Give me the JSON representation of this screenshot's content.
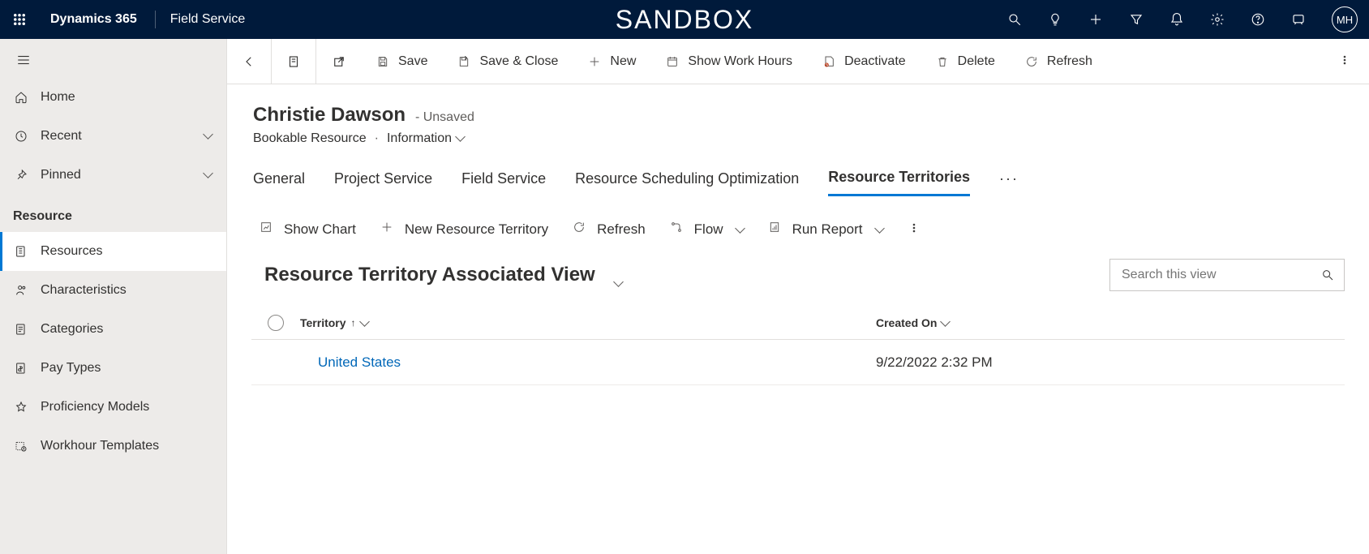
{
  "topbar": {
    "brand": "Dynamics 365",
    "app": "Field Service",
    "environment": "SANDBOX",
    "avatar": "MH"
  },
  "sidebar": {
    "home": "Home",
    "recent": "Recent",
    "pinned": "Pinned",
    "section": "Resource",
    "items": [
      "Resources",
      "Characteristics",
      "Categories",
      "Pay Types",
      "Proficiency Models",
      "Workhour Templates"
    ]
  },
  "cmdbar": {
    "save": "Save",
    "saveClose": "Save & Close",
    "new": "New",
    "workHours": "Show Work Hours",
    "deactivate": "Deactivate",
    "delete": "Delete",
    "refresh": "Refresh"
  },
  "record": {
    "title": "Christie Dawson",
    "status": "- Unsaved",
    "entity": "Bookable Resource",
    "form": "Information"
  },
  "tabs": [
    "General",
    "Project Service",
    "Field Service",
    "Resource Scheduling Optimization",
    "Resource Territories"
  ],
  "subcmd": {
    "showChart": "Show Chart",
    "newTerritory": "New Resource Territory",
    "refresh": "Refresh",
    "flow": "Flow",
    "runReport": "Run Report"
  },
  "view": {
    "title": "Resource Territory Associated View",
    "searchPlaceholder": "Search this view"
  },
  "grid": {
    "colTerritory": "Territory",
    "colCreated": "Created On",
    "rows": [
      {
        "territory": "United States",
        "created": "9/22/2022 2:32 PM"
      }
    ]
  }
}
